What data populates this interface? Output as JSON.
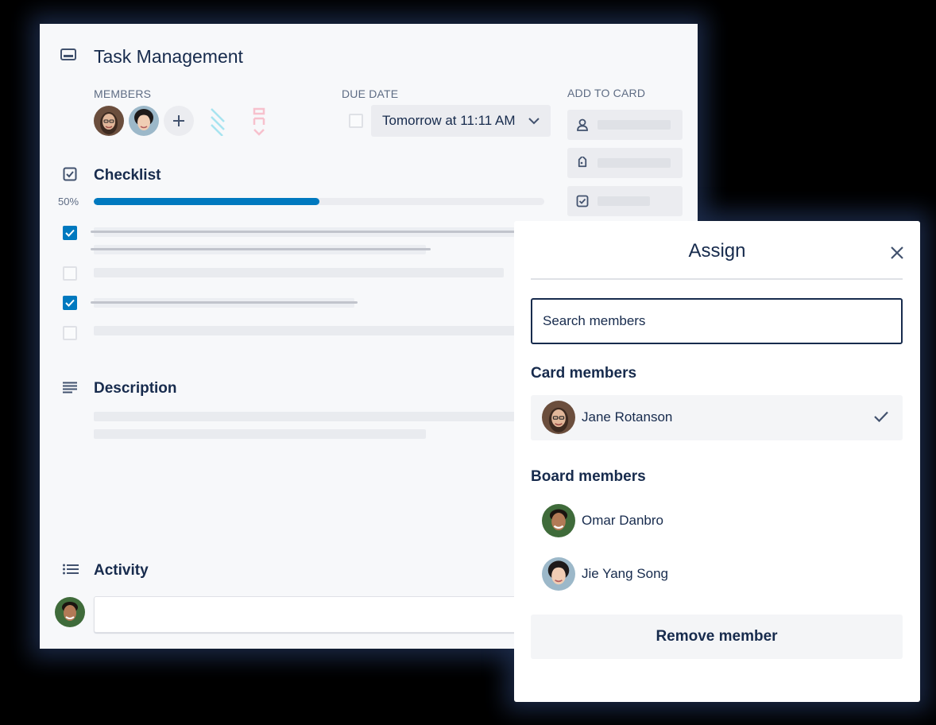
{
  "colors": {
    "accent": "#0079bf",
    "text": "#172b4d",
    "subtle": "#5e6c84",
    "surface": "#f7f8fa",
    "button_bg": "#ebecf0"
  },
  "card": {
    "title": "Task Management",
    "title_icon": "card-icon",
    "members": {
      "label": "MEMBERS",
      "avatars": [
        "jane-rotanson-avatar",
        "jie-yang-song-avatar"
      ],
      "add_icon": "plus-icon"
    },
    "due_date": {
      "label": "DUE DATE",
      "value": "Tomorrow at 11:11 AM",
      "checked": false
    },
    "add_to_card": {
      "label": "ADD TO CARD",
      "buttons": [
        {
          "icon": "person-icon"
        },
        {
          "icon": "tag-icon"
        },
        {
          "icon": "checkbox-icon"
        }
      ]
    },
    "checklist": {
      "title": "Checklist",
      "percent_label": "50%",
      "progress": 0.5,
      "items": [
        {
          "checked": true
        },
        {
          "checked": false
        },
        {
          "checked": true
        },
        {
          "checked": false
        }
      ]
    },
    "description": {
      "title": "Description"
    },
    "activity": {
      "title": "Activity"
    }
  },
  "assign_popover": {
    "title": "Assign",
    "search_placeholder": "Search members",
    "card_members_title": "Card members",
    "card_members": [
      {
        "name": "Jane Rotanson",
        "selected": true
      }
    ],
    "board_members_title": "Board members",
    "board_members": [
      {
        "name": "Omar Danbro"
      },
      {
        "name": "Jie Yang Song"
      }
    ],
    "remove_label": "Remove member"
  }
}
